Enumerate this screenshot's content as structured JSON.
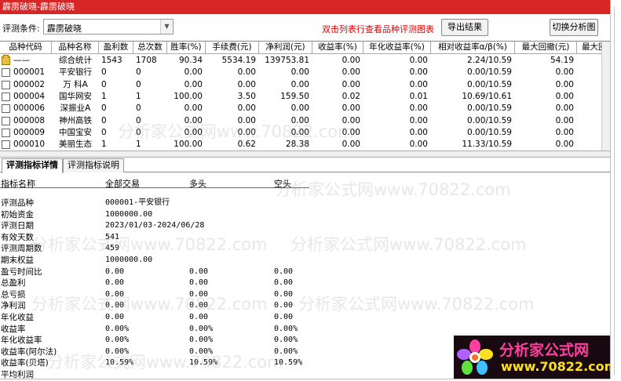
{
  "window": {
    "title": "霹雳破晓-霹雳破晓"
  },
  "toolbar": {
    "criteria_label": "评测条件:",
    "criteria_value": "霹雳破晓",
    "hint": "双击列表行查看品种评测图表",
    "export_label": "导出结果",
    "switch_label": "切换分析图"
  },
  "grid": {
    "columns": [
      "品种代码",
      "品种名称",
      "盈利数",
      "总次数",
      "胜率(%)",
      "手续费(元)",
      "净利润(元)",
      "收益率(%)",
      "年化收益率(%)",
      "相对收益率α/β(%)",
      "最大回撤(元)",
      "最大回"
    ],
    "rows": [
      {
        "code": "——",
        "name": "综合统计",
        "wins": "1543",
        "total": "1708",
        "winrate": "90.34",
        "fee": "5534.19",
        "profit": "139753.81",
        "ret": "0.00",
        "annual": "0.00",
        "relative": "2.24/10.59",
        "drawdown": "54.19"
      },
      {
        "code": "000001",
        "name": "平安银行",
        "wins": "0",
        "total": "0",
        "winrate": "0.00",
        "fee": "0.00",
        "profit": "0.00",
        "ret": "0.00",
        "annual": "0.00",
        "relative": "0.00/10.59",
        "drawdown": "0.00"
      },
      {
        "code": "000002",
        "name": "万 科A",
        "wins": "0",
        "total": "0",
        "winrate": "0.00",
        "fee": "0.00",
        "profit": "0.00",
        "ret": "0.00",
        "annual": "0.00",
        "relative": "0.00/10.59",
        "drawdown": "0.00"
      },
      {
        "code": "000004",
        "name": "国华网安",
        "wins": "1",
        "total": "1",
        "winrate": "100.00",
        "fee": "3.50",
        "profit": "159.50",
        "ret": "0.02",
        "annual": "0.01",
        "relative": "10.69/10.61",
        "drawdown": "0.00"
      },
      {
        "code": "000006",
        "name": "深振业A",
        "wins": "0",
        "total": "0",
        "winrate": "0.00",
        "fee": "0.00",
        "profit": "0.00",
        "ret": "0.00",
        "annual": "0.00",
        "relative": "0.00/10.59",
        "drawdown": "0.00"
      },
      {
        "code": "000008",
        "name": "神州高铁",
        "wins": "0",
        "total": "0",
        "winrate": "0.00",
        "fee": "0.00",
        "profit": "0.00",
        "ret": "0.00",
        "annual": "0.00",
        "relative": "0.00/10.59",
        "drawdown": "0.00"
      },
      {
        "code": "000009",
        "name": "中国宝安",
        "wins": "0",
        "total": "0",
        "winrate": "0.00",
        "fee": "0.00",
        "profit": "0.00",
        "ret": "0.00",
        "annual": "0.00",
        "relative": "0.00/10.59",
        "drawdown": "0.00"
      },
      {
        "code": "000010",
        "name": "美丽生态",
        "wins": "1",
        "total": "1",
        "winrate": "100.00",
        "fee": "0.62",
        "profit": "28.38",
        "ret": "0.00",
        "annual": "0.00",
        "relative": "11.33/10.59",
        "drawdown": "0.00"
      }
    ]
  },
  "tabs": [
    {
      "label": "评测指标详情",
      "active": true
    },
    {
      "label": "评测指标说明",
      "active": false
    }
  ],
  "details": {
    "headers": [
      "指标名称",
      "全部交易",
      "多头",
      "空头"
    ],
    "rows": [
      {
        "label": "评测品种",
        "all": "000001-平安银行",
        "long": "",
        "short": ""
      },
      {
        "label": "初始资金",
        "all": "1000000.00",
        "long": "",
        "short": ""
      },
      {
        "label": "评测日期",
        "all": "2023/01/03-2024/06/28",
        "long": "",
        "short": ""
      },
      {
        "label": "有效天数",
        "all": "541",
        "long": "",
        "short": ""
      },
      {
        "label": "评测周期数",
        "all": "459",
        "long": "",
        "short": ""
      },
      {
        "label": "期末权益",
        "all": "1000000.00",
        "long": "",
        "short": ""
      },
      {
        "label": "盈亏时间比",
        "all": "0.00",
        "long": "0.00",
        "short": "0.00"
      },
      {
        "label": "总盈利",
        "all": "0.00",
        "long": "0.00",
        "short": "0.00"
      },
      {
        "label": "总亏损",
        "all": "0.00",
        "long": "0.00",
        "short": "0.00"
      },
      {
        "label": "净利润",
        "all": "0.00",
        "long": "0.00",
        "short": "0.00"
      },
      {
        "label": "年化收益",
        "all": "0.00",
        "long": "0.00",
        "short": "0.00"
      },
      {
        "label": "收益率",
        "all": "0.00%",
        "long": "0.00%",
        "short": "0.00%"
      },
      {
        "label": "年化收益率",
        "all": "0.00%",
        "long": "0.00%",
        "short": "0.00%"
      },
      {
        "label": "收益率(阿尔法)",
        "all": "0.00%",
        "long": "0.00%",
        "short": "0.00%"
      },
      {
        "label": "收益率(贝塔)",
        "all": "10.59%",
        "long": "10.59%",
        "short": "10.59%"
      },
      {
        "label": "平均利润",
        "all": "",
        "long": "",
        "short": ""
      }
    ]
  },
  "watermark": {
    "text": "分析家公式网www.70822.com"
  },
  "logo": {
    "title": "分析家公式网",
    "url": "www.70822.com"
  },
  "colors": {
    "titlebar": "#d82626",
    "hint": "#e00000",
    "logo_bg": "#180a10",
    "logo_title": "#ff3fa0",
    "logo_url": "#ffe020"
  }
}
